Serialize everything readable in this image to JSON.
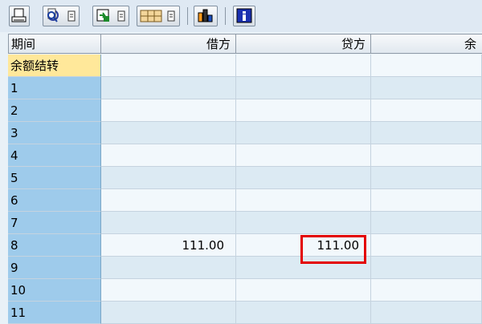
{
  "toolbar": {
    "buttons": [
      {
        "icon": "print-icon"
      },
      {
        "icon": "find-icon",
        "dropdown": true
      },
      {
        "icon": "export-icon",
        "dropdown": true
      },
      {
        "icon": "layout-icon",
        "dropdown": true
      },
      {
        "icon": "chart-icon"
      },
      {
        "icon": "info-icon"
      }
    ]
  },
  "table": {
    "headers": [
      "期间",
      "借方",
      "贷方",
      "余"
    ],
    "rows": [
      {
        "period": "余额结转",
        "debit": "",
        "credit": ""
      },
      {
        "period": "1",
        "debit": "",
        "credit": ""
      },
      {
        "period": "2",
        "debit": "",
        "credit": ""
      },
      {
        "period": "3",
        "debit": "",
        "credit": ""
      },
      {
        "period": "4",
        "debit": "",
        "credit": ""
      },
      {
        "period": "5",
        "debit": "",
        "credit": ""
      },
      {
        "period": "6",
        "debit": "",
        "credit": ""
      },
      {
        "period": "7",
        "debit": "",
        "credit": ""
      },
      {
        "period": "8",
        "debit": "111.00",
        "credit": "111.00"
      },
      {
        "period": "9",
        "debit": "",
        "credit": ""
      },
      {
        "period": "10",
        "debit": "",
        "credit": ""
      },
      {
        "period": "11",
        "debit": "",
        "credit": ""
      }
    ]
  },
  "colors": {
    "period_column": "#9ecbeb",
    "selected_period": "#ffe89a",
    "highlight_box": "#e30000"
  }
}
